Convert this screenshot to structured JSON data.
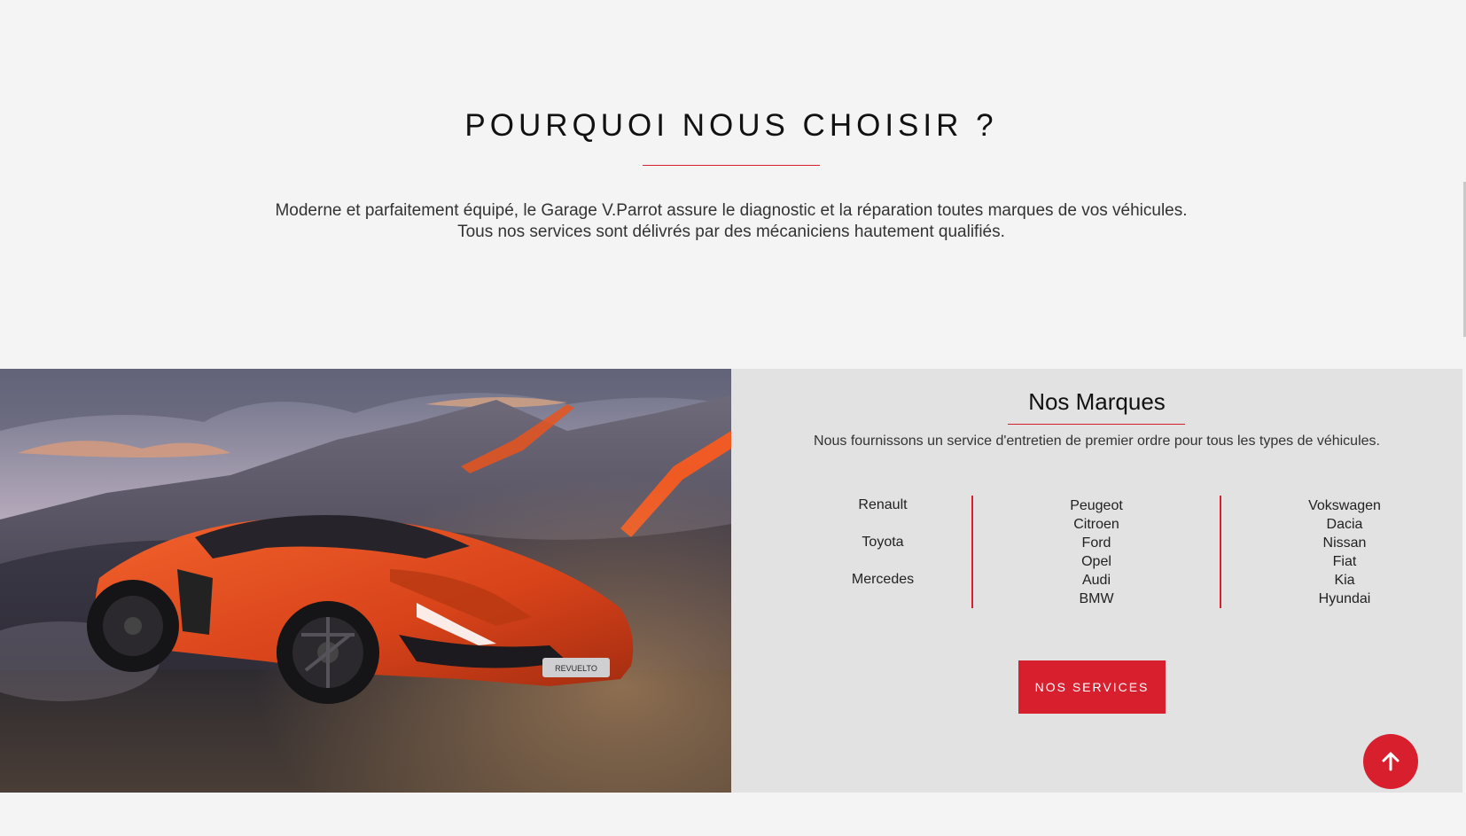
{
  "why": {
    "title": "POURQUOI NOUS CHOISIR ?",
    "line1": "Moderne et parfaitement équipé, le Garage V.Parrot assure le diagnostic et la réparation toutes marques de vos véhicules.",
    "line2": "Tous nos services sont délivrés par des mécaniciens hautement qualifiés."
  },
  "hero": {
    "image_alt": "orange sports car with volcanic mountains",
    "badge": "REVUELTO"
  },
  "brands": {
    "title": "Nos Marques",
    "subtitle": "Nous fournissons un service d'entretien de premier ordre pour tous les types de véhicules.",
    "col1": [
      "Renault",
      "Toyota",
      "Mercedes"
    ],
    "col2": [
      "Peugeot",
      "Citroen",
      "Ford",
      "Opel",
      "Audi",
      "BMW"
    ],
    "col3": [
      "Vokswagen",
      "Dacia",
      "Nissan",
      "Fiat",
      "Kia",
      "Hyundai"
    ],
    "button_label": "NOS SERVICES"
  },
  "back_to_top": {
    "icon": "arrow-up-icon"
  },
  "colors": {
    "accent": "#d71f2e",
    "panel": "#e2e2e2",
    "background": "#f4f4f4"
  }
}
